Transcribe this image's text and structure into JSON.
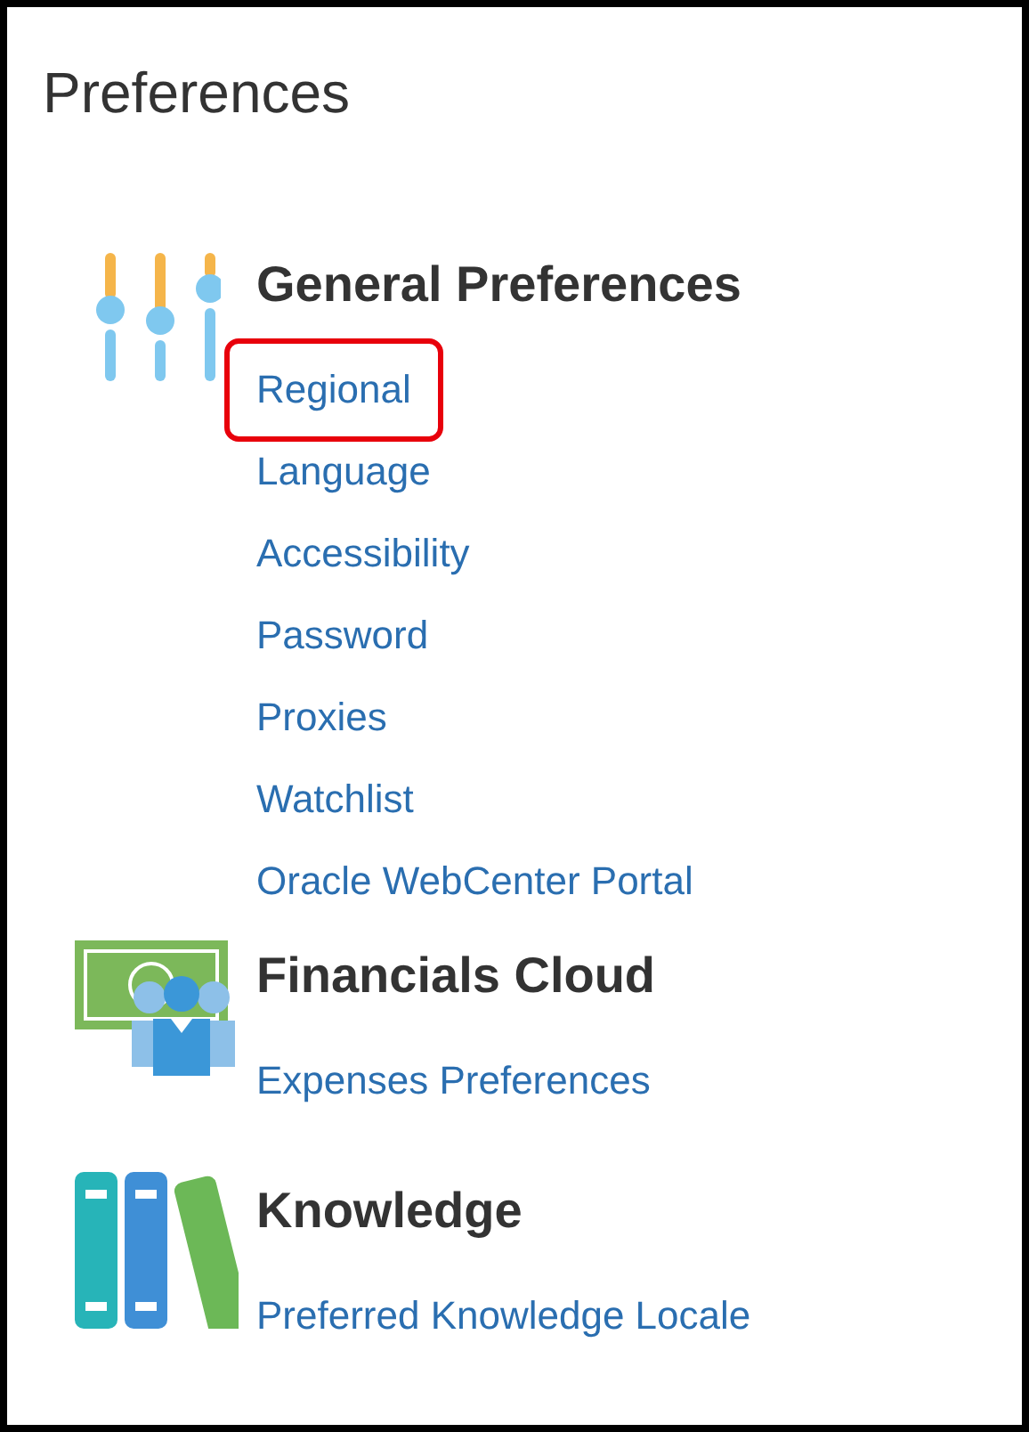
{
  "title": "Preferences",
  "sections": [
    {
      "kind": "sliders",
      "heading": "General Preferences",
      "links": [
        {
          "label": "Regional",
          "selected": true
        },
        {
          "label": "Language",
          "selected": false
        },
        {
          "label": "Accessibility",
          "selected": false
        },
        {
          "label": "Password",
          "selected": false
        },
        {
          "label": "Proxies",
          "selected": false
        },
        {
          "label": "Watchlist",
          "selected": false
        },
        {
          "label": "Oracle WebCenter Portal",
          "selected": false
        }
      ]
    },
    {
      "kind": "money",
      "heading": "Financials Cloud",
      "links": [
        {
          "label": "Expenses Preferences",
          "selected": false
        }
      ]
    },
    {
      "kind": "books",
      "heading": "Knowledge",
      "links": [
        {
          "label": "Preferred Knowledge Locale",
          "selected": false
        }
      ]
    }
  ]
}
